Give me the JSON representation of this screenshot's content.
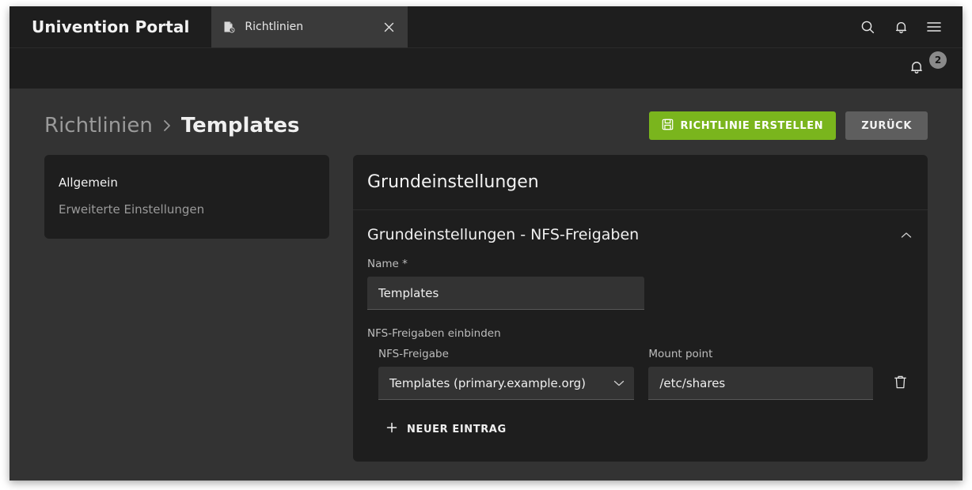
{
  "window": {
    "brand": "Univention Portal"
  },
  "topbar": {
    "tab": {
      "icon": "policy-document-icon",
      "label": "Richtlinien",
      "close_label": "×"
    },
    "actions": [
      {
        "name": "search-icon",
        "label": "Suche"
      },
      {
        "name": "bell-icon",
        "label": "Benachrichtigungen"
      },
      {
        "name": "hamburger-menu-icon",
        "label": "Menü"
      }
    ]
  },
  "notifications": {
    "icon": "bell-icon",
    "count": "2"
  },
  "page": {
    "breadcrumb": {
      "parent": "Richtlinien",
      "separator": "›",
      "current": "Templates"
    },
    "actions": {
      "primary": {
        "icon": "save-floppy-icon",
        "label": "RICHTLINIE ERSTELLEN"
      },
      "secondary": {
        "label": "ZURÜCK"
      }
    }
  },
  "sidebar": {
    "items": [
      {
        "label": "Allgemein",
        "state": "active"
      },
      {
        "label": "Erweiterte Einstellungen",
        "state": "muted"
      }
    ]
  },
  "panel": {
    "title": "Grundeinstellungen",
    "section": {
      "title": "Grundeinstellungen - NFS-Freigaben",
      "collapse_icon": "chevron-up-icon"
    },
    "name_field": {
      "label": "Name *",
      "value": "Templates",
      "placeholder": ""
    },
    "group": {
      "label": "NFS-Freigaben einbinden",
      "columns": {
        "share": "NFS-Freigabe",
        "mount_point": "Mount point"
      },
      "rows": [
        {
          "share": "Templates (primary.example.org)",
          "mount_point": "/etc/shares",
          "delete_icon": "trash-icon"
        }
      ],
      "add_button": {
        "icon": "plus-icon",
        "label": "NEUER EINTRAG"
      }
    }
  },
  "colors": {
    "accent_green": "#7ab51d",
    "page_bg": "#333333",
    "card_bg": "#1e1e1e",
    "badge_bg": "#8a8a8a"
  }
}
